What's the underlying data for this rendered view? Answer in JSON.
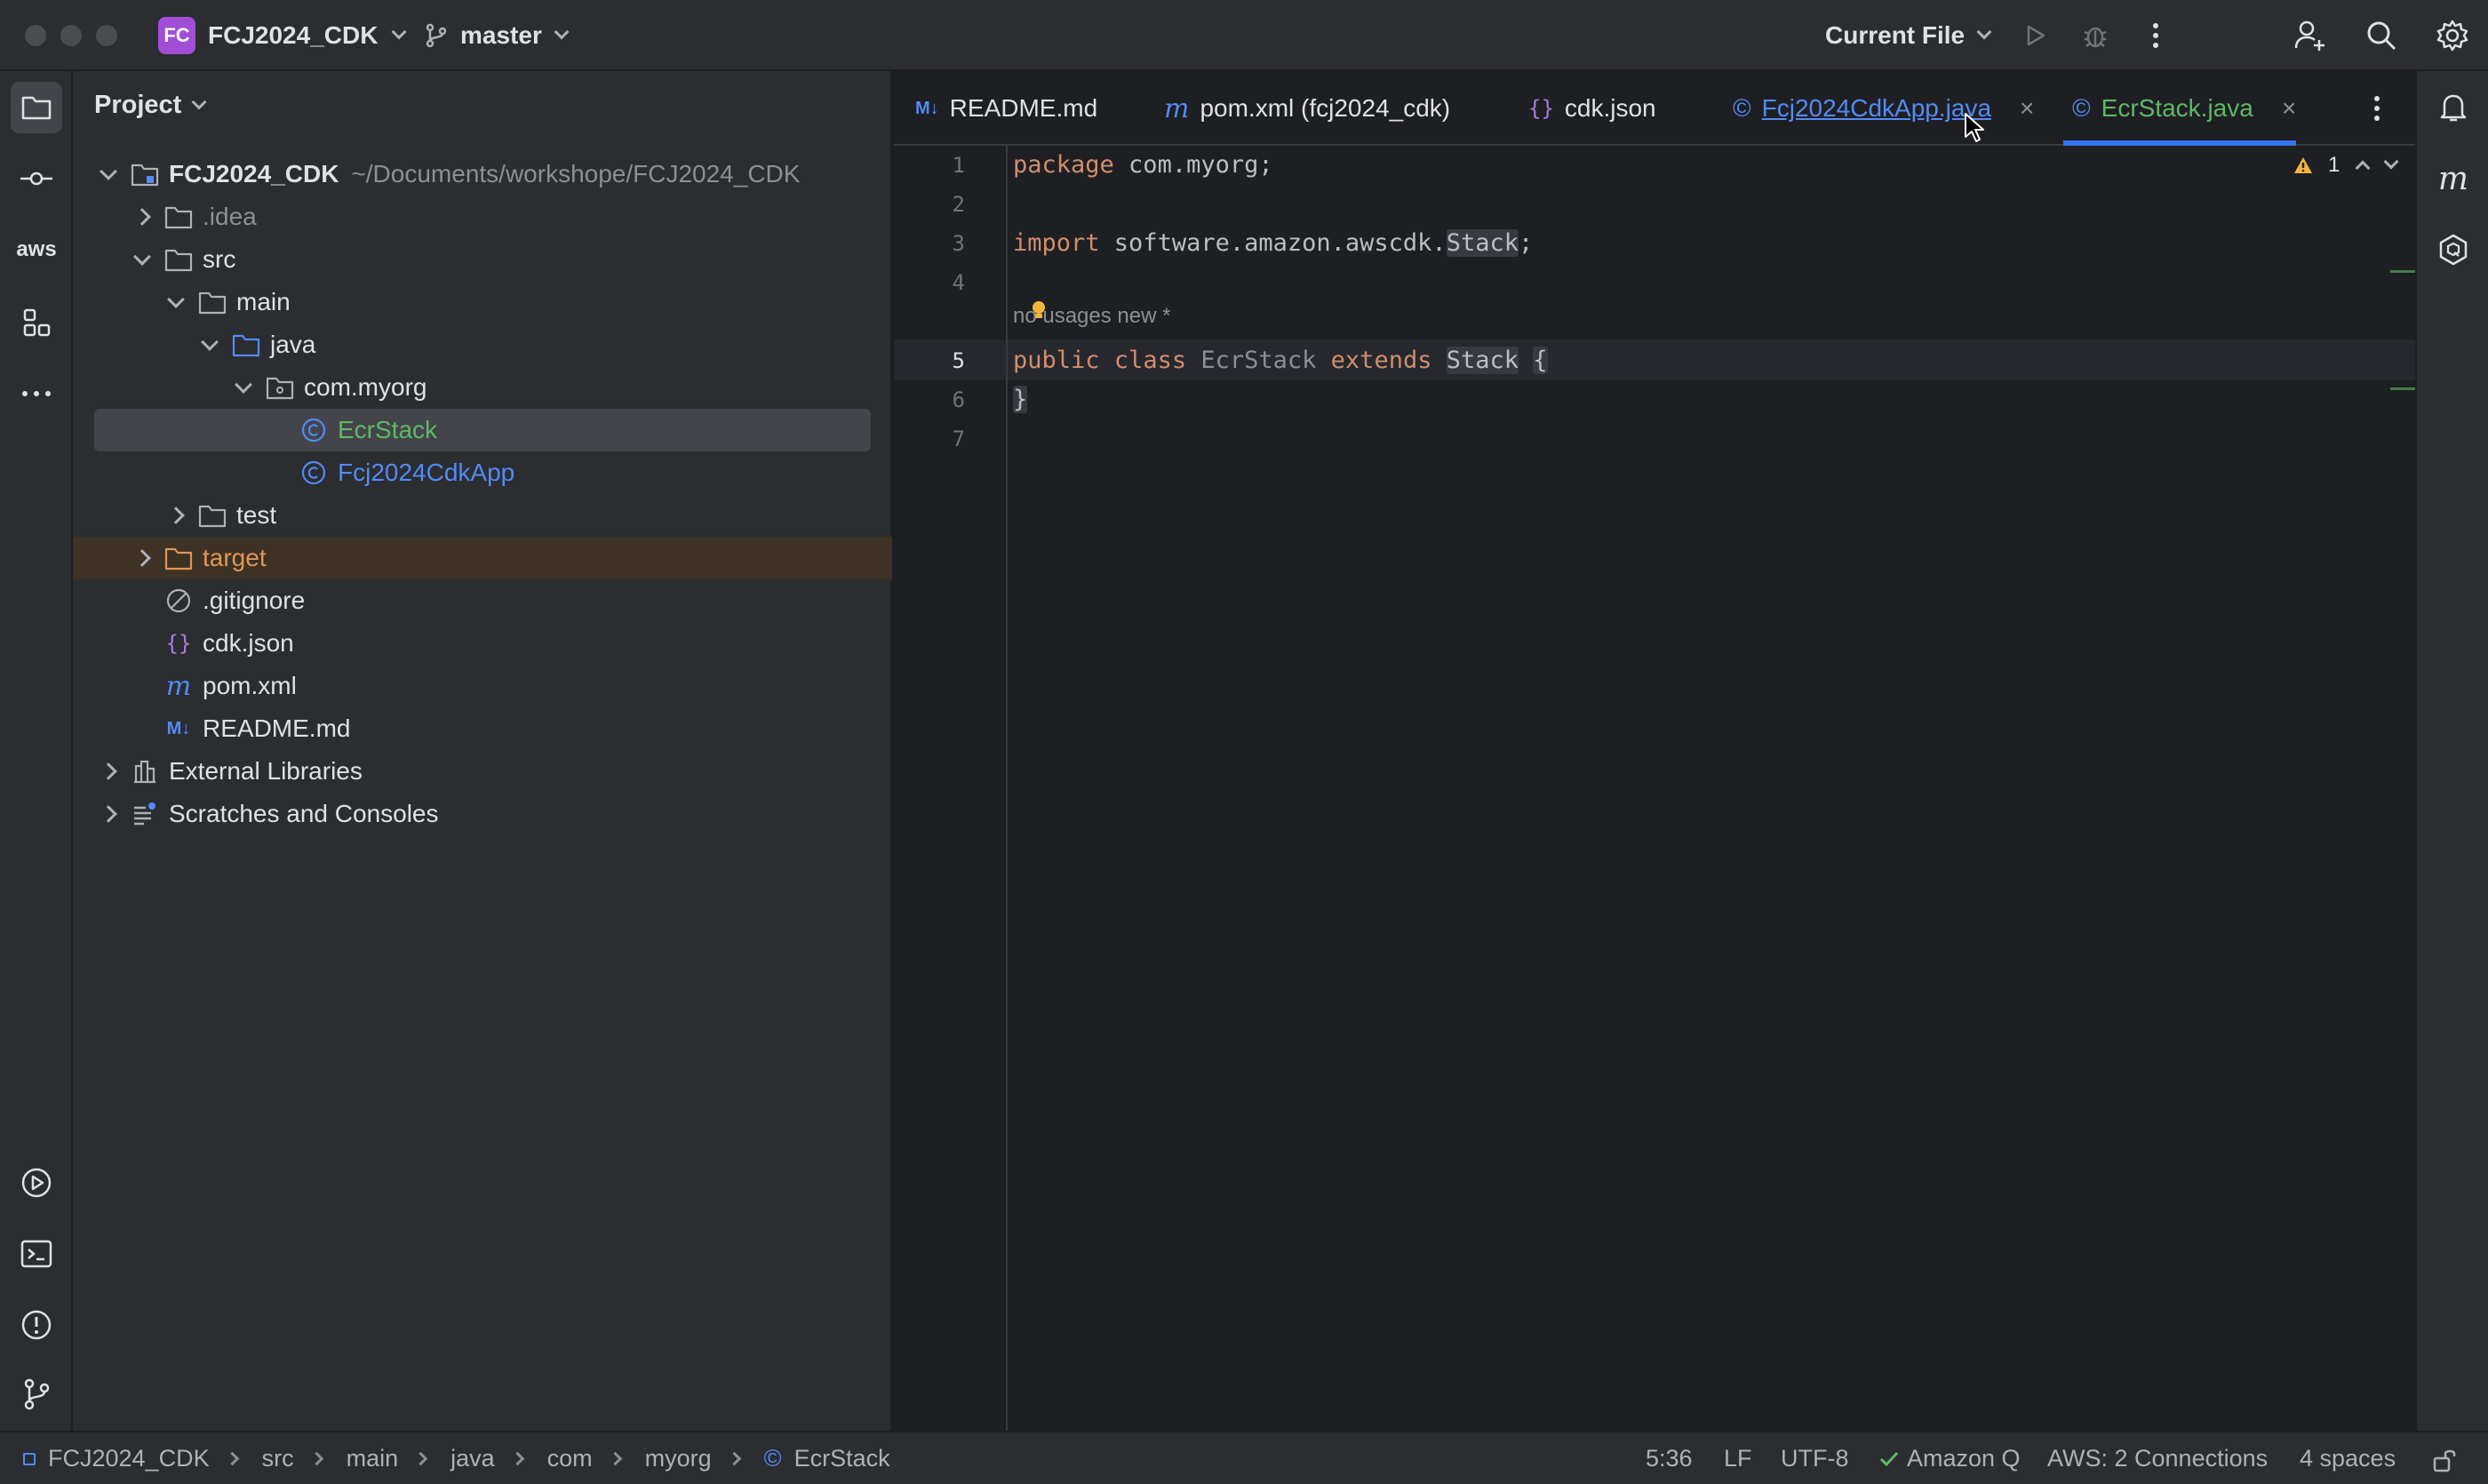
{
  "titlebar": {
    "project_badge": "FC",
    "project_name": "FCJ2024_CDK",
    "branch": "master",
    "run_config": "Current File",
    "icons": [
      "run-icon",
      "debug-icon",
      "more-icon",
      "add-user-icon",
      "search-icon",
      "settings-icon"
    ]
  },
  "left_strip": {
    "items": [
      "project-icon",
      "commit-icon",
      "aws-icon",
      "structure-icon",
      "more-tools-icon",
      "run-icon",
      "terminal-icon",
      "problems-icon",
      "git-icon"
    ],
    "aws_label": "aws"
  },
  "project_panel": {
    "title": "Project",
    "tree": [
      {
        "label": "FCJ2024_CDK",
        "path": "~/Documents/workshope/FCJ2024_CDK",
        "state": "open",
        "icon": "module-folder-icon"
      },
      {
        "label": ".idea",
        "state": "closed",
        "icon": "folder-icon"
      },
      {
        "label": "src",
        "state": "open",
        "icon": "folder-icon"
      },
      {
        "label": "main",
        "state": "open",
        "icon": "folder-icon"
      },
      {
        "label": "java",
        "state": "open",
        "icon": "source-folder-icon"
      },
      {
        "label": "com.myorg",
        "state": "open",
        "icon": "package-icon"
      },
      {
        "label": "EcrStack",
        "state": "none",
        "icon": "java-class-icon"
      },
      {
        "label": "Fcj2024CdkApp",
        "state": "none",
        "icon": "java-class-icon"
      },
      {
        "label": "test",
        "state": "closed",
        "icon": "folder-icon"
      },
      {
        "label": "target",
        "state": "closed",
        "icon": "excluded-folder-icon"
      },
      {
        "label": ".gitignore",
        "state": "none",
        "icon": "ignore-file-icon"
      },
      {
        "label": "cdk.json",
        "state": "none",
        "icon": "json-file-icon"
      },
      {
        "label": "pom.xml",
        "state": "none",
        "icon": "maven-file-icon"
      },
      {
        "label": "README.md",
        "state": "none",
        "icon": "markdown-file-icon"
      },
      {
        "label": "External Libraries",
        "state": "closed",
        "icon": "libraries-icon"
      },
      {
        "label": "Scratches and Consoles",
        "state": "closed",
        "icon": "scratches-icon"
      }
    ]
  },
  "tabs": [
    {
      "label": "README.md",
      "icon": "markdown-file-icon",
      "prefix": "M↓"
    },
    {
      "label": "pom.xml (fcj2024_cdk)",
      "icon": "maven-file-icon",
      "prefix": "m"
    },
    {
      "label": "cdk.json",
      "icon": "json-file-icon",
      "prefix": "{}"
    },
    {
      "label": "Fcj2024CdkApp.java",
      "icon": "java-class-icon",
      "prefix": "©",
      "close": "×"
    },
    {
      "label": "EcrStack.java",
      "icon": "java-class-icon",
      "prefix": "©",
      "close": "×",
      "active": true
    }
  ],
  "editor": {
    "line_numbers": [
      "1",
      "2",
      "3",
      "4",
      "5",
      "6",
      "7"
    ],
    "inlay_hint": "no usages   new *",
    "warning_count": "1",
    "lines": {
      "l1_kw": "package",
      "l1_rest": " com.myorg;",
      "l3_kw": "import",
      "l3_rest": " software.amazon.awscdk.",
      "l3_cls": "Stack",
      "l3_end": ";",
      "l5_kw1": "public",
      "l5_kw2": "class",
      "l5_name": "EcrStack",
      "l5_kw3": "extends",
      "l5_sup": "Stack",
      "l5_brace": "{",
      "l6_brace": "}"
    }
  },
  "statusbar": {
    "breadcrumb": [
      "FCJ2024_CDK",
      "src",
      "main",
      "java",
      "com",
      "myorg",
      "EcrStack"
    ],
    "cursor": "5:36",
    "line_ending": "LF",
    "encoding": "UTF-8",
    "amazon_q": "Amazon Q",
    "aws": "AWS: 2 Connections",
    "indent": "4 spaces"
  },
  "colors": {
    "accent": "#3574f0",
    "class_blue": "#548af7",
    "modified_green": "#5fb865",
    "excluded_orange": "#e0955b",
    "keyword": "#cf8e6d",
    "folder": "#aeb1b6"
  }
}
